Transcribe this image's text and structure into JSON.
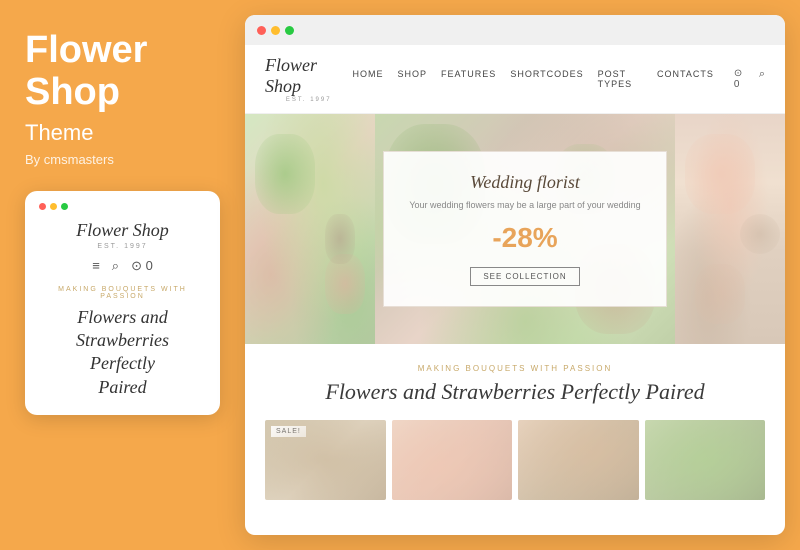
{
  "left": {
    "title_line1": "Flower",
    "title_line2": "Shop",
    "subtitle": "Theme",
    "by": "By cmsmasters",
    "mobile_card": {
      "logo": "Flower Shop",
      "est": "EST. 1997",
      "tagline": "Making Bouquets With Passion",
      "heading": "Flowers and Strawberries Perfectly Paired"
    }
  },
  "browser": {
    "nav": {
      "logo": "Flower Shop",
      "est": "EST. 1997",
      "links": [
        "Home",
        "Shop",
        "Features",
        "Shortcodes",
        "Post Types",
        "Contacts"
      ],
      "cart_count": "0"
    },
    "hero": {
      "card": {
        "title": "Wedding florist",
        "subtitle": "Your wedding flowers may be a large part of your wedding",
        "discount": "-28%",
        "button": "SEE COLLECTION"
      }
    },
    "content": {
      "tagline": "Making Bouquets With Passion",
      "heading": "Flowers and Strawberries Perfectly Paired"
    },
    "products": [
      {
        "sale": "SALE!"
      },
      {},
      {},
      {}
    ]
  },
  "colors": {
    "orange": "#F5A84B",
    "white": "#FFFFFF",
    "dot1": "#FF6058",
    "dot2": "#FFBD2E",
    "dot3": "#28CA42",
    "accent_gold": "#C8A96A",
    "discount_color": "#E8A45A"
  },
  "icons": {
    "hamburger": "≡",
    "search": "🔍",
    "cart": "🛒",
    "cart_icon": "⊙"
  }
}
